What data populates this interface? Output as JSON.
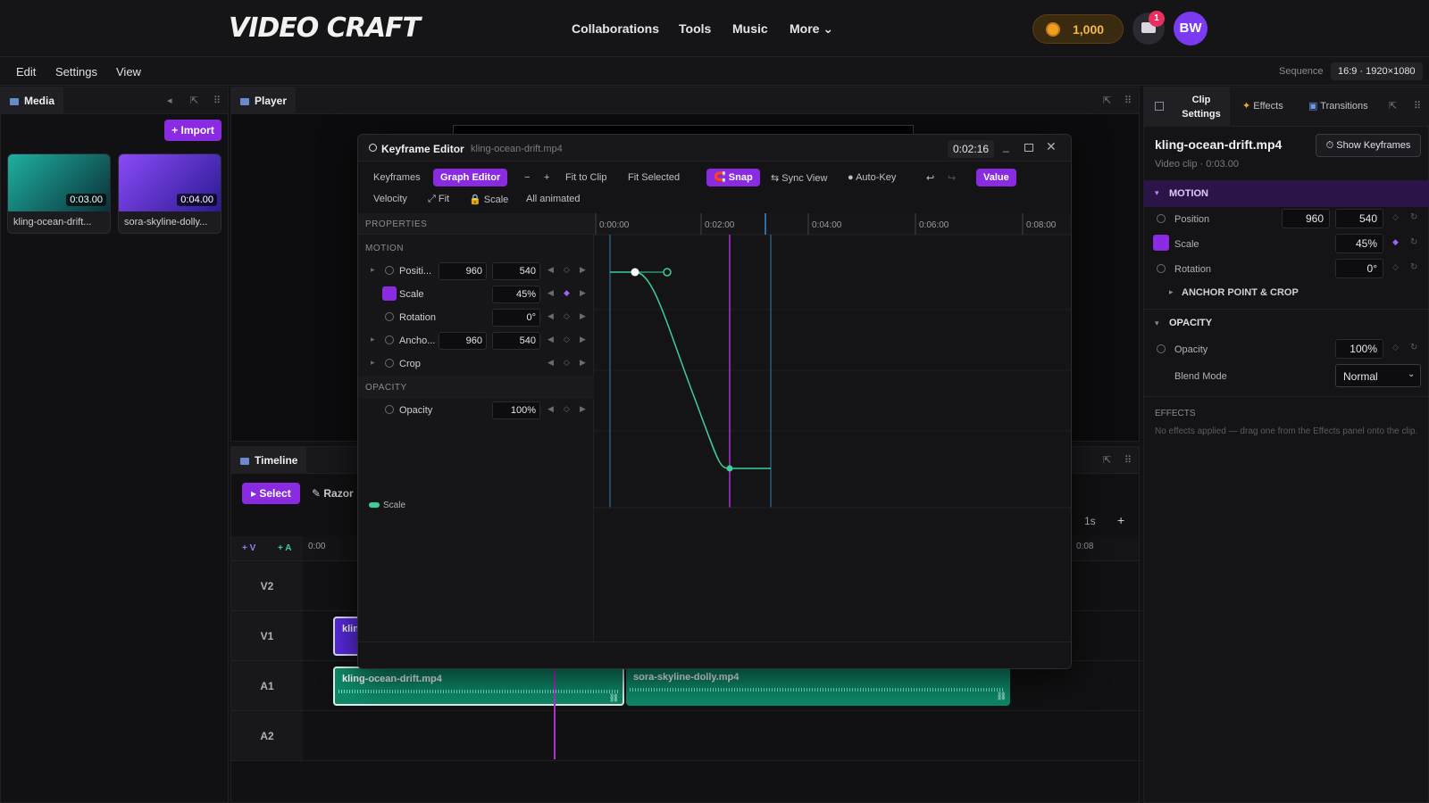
{
  "app": {
    "logo": "VIDEO CRAFT"
  },
  "nav": {
    "links": [
      "Collaborations",
      "Tools",
      "Music",
      "More ⌄"
    ],
    "coins": "1,000",
    "mail_badge": "1",
    "avatar": "BW"
  },
  "menu": {
    "items": [
      "Edit",
      "Settings",
      "View"
    ],
    "sequence_label": "Sequence",
    "sequence_value": "16:9 · 1920×1080"
  },
  "media": {
    "tab": "Media",
    "import_label": "+ Import",
    "items": [
      {
        "name": "kling-ocean-drift.mp4",
        "display": "kling-ocean-drift...",
        "duration": "0:03.00",
        "color_a": "#1a8a7a",
        "color_b": "#0a3a40"
      },
      {
        "name": "sora-skyline-dolly.mp4",
        "display": "sora-skyline-dolly...",
        "duration": "0:04.00",
        "color_a": "#7a3af2",
        "color_b": "#2a1a8a"
      }
    ]
  },
  "player": {
    "tab": "Player"
  },
  "timeline": {
    "tab": "Timeline",
    "tools": {
      "select": "Select",
      "razor": "Razor"
    },
    "add_video": "+ V",
    "add_audio": "+ A",
    "ruler_start": "0:00",
    "ruler_end": "0:08",
    "zoom_label": "1s",
    "zoom_plus": "+",
    "tracks": [
      "V2",
      "V1",
      "A1",
      "A2"
    ],
    "clips": {
      "v1": "klin",
      "a1_first": "kling-ocean-drift.mp4",
      "a1_second": "sora-skyline-dolly.mp4"
    }
  },
  "keyframe_editor": {
    "title": "Keyframe Editor",
    "file": "kling-ocean-drift.mp4",
    "time": "0:02:16",
    "toolbar": {
      "keyframes": "Keyframes",
      "graph_editor": "Graph Editor",
      "minus": "−",
      "plus": "+",
      "fit_to_clip": "Fit to Clip",
      "fit_selected": "Fit Selected",
      "snap": "Snap",
      "sync_view": "⇆ Sync View",
      "auto_key": "● Auto-Key",
      "undo": "↩",
      "redo": "↪",
      "value": "Value",
      "velocity": "Velocity",
      "fit": "⤢ Fit",
      "scale": "Scale",
      "all_animated": "All animated"
    },
    "properties_header": "PROPERTIES",
    "sections": {
      "motion": "MOTION",
      "opacity": "OPACITY"
    },
    "rows": {
      "position": {
        "name": "Positi...",
        "x": "960",
        "y": "540"
      },
      "scale": {
        "name": "Scale",
        "v": "45%"
      },
      "rotation": {
        "name": "Rotation",
        "v": "0°"
      },
      "anchor": {
        "name": "Ancho...",
        "x": "960",
        "y": "540"
      },
      "crop": {
        "name": "Crop"
      },
      "opacity": {
        "name": "Opacity",
        "v": "100%"
      }
    },
    "ruler": [
      "0:00:00",
      "0:02:00",
      "0:04:00",
      "0:06:00",
      "0:08:00"
    ],
    "legend": "Scale",
    "curve_color": "#3ccf9a"
  },
  "clip_settings": {
    "tabs": {
      "clip_settings": "Clip Settings",
      "effects": "Effects",
      "transitions": "Transitions"
    },
    "clip_name": "kling-ocean-drift.mp4",
    "clip_meta": "Video clip · 0:03.00",
    "show_keyframes": "⏱ Show Keyframes",
    "motion": "MOTION",
    "position": {
      "label": "Position",
      "x": "960",
      "y": "540"
    },
    "scale": {
      "label": "Scale",
      "v": "45%"
    },
    "rotation": {
      "label": "Rotation",
      "v": "0°"
    },
    "anchor": "ANCHOR POINT & CROP",
    "opacity_header": "OPACITY",
    "opacity": {
      "label": "Opacity",
      "v": "100%"
    },
    "blend": {
      "label": "Blend Mode",
      "v": "Normal"
    },
    "effects_header": "EFFECTS",
    "effects_empty": "No effects applied — drag one from the Effects panel onto the clip."
  },
  "colors": {
    "accent": "#8a2be2",
    "audio_clip": "#0f8a6a",
    "playhead": "#b030d0"
  }
}
